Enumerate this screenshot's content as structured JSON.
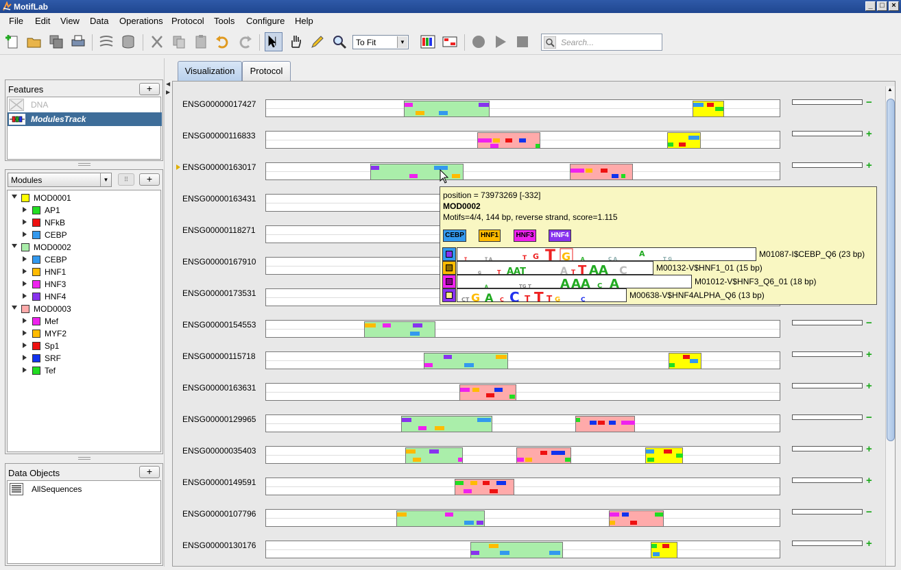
{
  "window": {
    "title": "MotifLab"
  },
  "menu": [
    "File",
    "Edit",
    "View",
    "Data",
    "Operations",
    "Protocol",
    "Tools",
    "Configure",
    "Help"
  ],
  "toolbar": {
    "zoom_value": "To Fit",
    "search_placeholder": "Search..."
  },
  "features": {
    "title": "Features",
    "add_label": "+",
    "items": [
      {
        "label": "DNA",
        "state": "disabled"
      },
      {
        "label": "ModulesTrack",
        "state": "selected"
      }
    ]
  },
  "modules": {
    "selector": "Modules",
    "add_label": "+",
    "tree": [
      {
        "name": "MOD0001",
        "color": "#ffff00",
        "children": [
          {
            "name": "AP1",
            "color": "#22dd22"
          },
          {
            "name": "NFkB",
            "color": "#ee1111"
          },
          {
            "name": "CEBP",
            "color": "#3399ee"
          }
        ]
      },
      {
        "name": "MOD0002",
        "color": "#aaeeaa",
        "children": [
          {
            "name": "CEBP",
            "color": "#3399ee"
          },
          {
            "name": "HNF1",
            "color": "#ffbb00"
          },
          {
            "name": "HNF3",
            "color": "#ee22ee"
          },
          {
            "name": "HNF4",
            "color": "#8833ee"
          }
        ]
      },
      {
        "name": "MOD0003",
        "color": "#ffaaaa",
        "children": [
          {
            "name": "Mef",
            "color": "#ee22ee"
          },
          {
            "name": "MYF2",
            "color": "#ffbb00"
          },
          {
            "name": "Sp1",
            "color": "#ee1111"
          },
          {
            "name": "SRF",
            "color": "#1133ee"
          },
          {
            "name": "Tef",
            "color": "#22dd22"
          }
        ]
      }
    ]
  },
  "data_objects": {
    "title": "Data Objects",
    "add_label": "+",
    "items": [
      "AllSequences"
    ]
  },
  "tabs": [
    {
      "label": "Visualization",
      "active": true
    },
    {
      "label": "Protocol",
      "active": false
    }
  ],
  "sequences": [
    {
      "name": "ENSG00000017427",
      "sign": "−"
    },
    {
      "name": "ENSG00000116833",
      "sign": "+"
    },
    {
      "name": "ENSG00000163017",
      "sign": "+"
    },
    {
      "name": "ENSG00000163431",
      "sign": ""
    },
    {
      "name": "ENSG00000118271",
      "sign": ""
    },
    {
      "name": "ENSG00000167910",
      "sign": ""
    },
    {
      "name": "ENSG00000173531",
      "sign": ""
    },
    {
      "name": "ENSG00000154553",
      "sign": "−"
    },
    {
      "name": "ENSG00000115718",
      "sign": "+"
    },
    {
      "name": "ENSG00000163631",
      "sign": "+"
    },
    {
      "name": "ENSG00000129965",
      "sign": "−"
    },
    {
      "name": "ENSG00000035403",
      "sign": "+"
    },
    {
      "name": "ENSG00000149591",
      "sign": "+"
    },
    {
      "name": "ENSG00000107796",
      "sign": "−"
    },
    {
      "name": "ENSG00000130176",
      "sign": "+"
    }
  ],
  "tooltip": {
    "position": "position = 73973269 [-332]",
    "module": "MOD0002",
    "details": "Motifs=4/4, 144 bp, reverse strand, score=1.115",
    "badges": [
      {
        "label": "CEBP",
        "color": "#3399ee"
      },
      {
        "label": "HNF1",
        "color": "#ffbb00"
      },
      {
        "label": "HNF3",
        "color": "#ee22ee"
      },
      {
        "label": "HNF4",
        "color": "#8833ee"
      }
    ],
    "motifs": [
      {
        "label": "M01087-I$CEBP_Q6   (23 bp)",
        "color": "#3399ee"
      },
      {
        "label": "M00132-V$HNF1_01   (15 bp)",
        "color": "#ffbb00"
      },
      {
        "label": "M01012-V$HNF3_Q6_01   (18 bp)",
        "color": "#ee22ee"
      },
      {
        "label": "M00638-V$HNF4ALPHA_Q6   (13 bp)",
        "color": "#8833ee"
      }
    ]
  }
}
